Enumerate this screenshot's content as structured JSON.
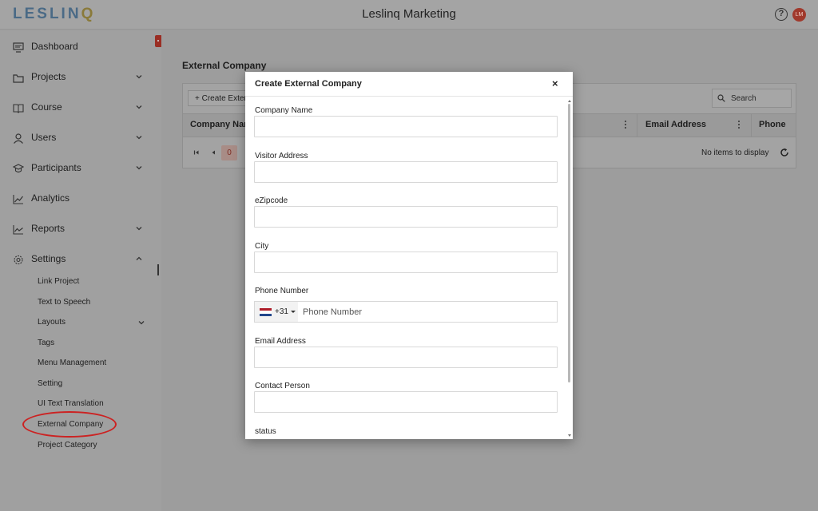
{
  "header": {
    "logo_prefix": "LESLIN",
    "logo_suffix": "Q",
    "title": "Leslinq Marketing",
    "help_icon": "help-circle-icon",
    "avatar_initials": "LM",
    "avatar_color": "#a0392c"
  },
  "sidebar": {
    "items": [
      {
        "label": "Dashboard",
        "icon": "monitor-icon"
      },
      {
        "label": "Projects",
        "icon": "folder-icon"
      },
      {
        "label": "Course",
        "icon": "book-icon"
      },
      {
        "label": "Users",
        "icon": "user-icon"
      },
      {
        "label": "Participants",
        "icon": "graduation-cap-icon"
      },
      {
        "label": "Analytics",
        "icon": "trend-chart-icon"
      },
      {
        "label": "Reports",
        "icon": "line-chart-icon"
      },
      {
        "label": "Settings",
        "icon": "gear-icon"
      }
    ],
    "settings_sub": [
      "Link Project",
      "Text to Speech",
      "Layouts",
      "Tags",
      "Menu Management",
      "Setting",
      "UI Text Translation",
      "External Company",
      "Project Category"
    ]
  },
  "main": {
    "page_title": "External Company",
    "create_button": "+ Create External Company",
    "search_placeholder": "Search",
    "columns": {
      "company_name": "Company Name",
      "email": "Email Address",
      "phone": "Phone"
    },
    "page_number": "0",
    "no_items": "No items to display"
  },
  "modal": {
    "title": "Create External Company",
    "close": "×",
    "fields": {
      "company_name": "Company Name",
      "visitor_address": "Visitor Address",
      "zipcode": "eZipcode",
      "city": "City",
      "phone_number": "Phone Number",
      "email": "Email Address",
      "contact_person": "Contact Person",
      "status": "status"
    },
    "phone": {
      "dial_code": "+31",
      "placeholder": "Phone Number",
      "flag": "netherlands-flag-icon"
    }
  },
  "colors": {
    "accent": "#9a2e24",
    "highlight": "#cc2222"
  }
}
